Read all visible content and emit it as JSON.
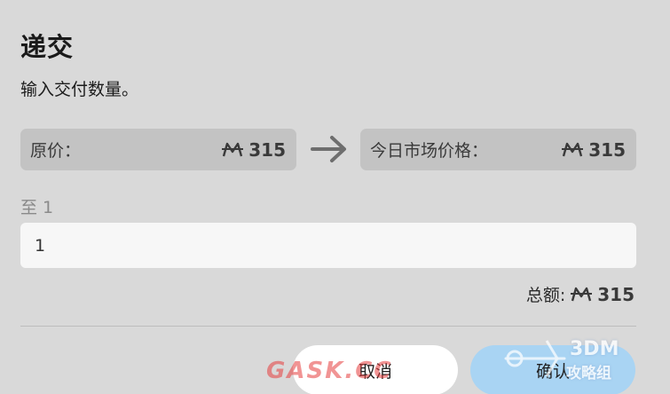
{
  "dialog": {
    "title": "递交",
    "subtitle": "输入交付数量。"
  },
  "prices": {
    "original_label": "原价：",
    "original_value": "315",
    "market_label": "今日市场价格：",
    "market_value": "315",
    "currency_icon": "m-coin-icon",
    "arrow_icon": "arrow-right-icon"
  },
  "quantity": {
    "range_label": "至 1",
    "value": "1"
  },
  "total": {
    "label": "总额:",
    "value": "315"
  },
  "buttons": {
    "cancel_label": "取消",
    "confirm_label": "确认"
  },
  "watermarks": {
    "left": "GASK.CC",
    "right_line1": "3DM",
    "right_line2": "攻略组"
  },
  "colors": {
    "background": "#d9d9d9",
    "price_box": "#c3c3c3",
    "confirm_button": "#a9d4f3",
    "cancel_button": "#ffffff",
    "input_background": "#f7f7f7"
  }
}
